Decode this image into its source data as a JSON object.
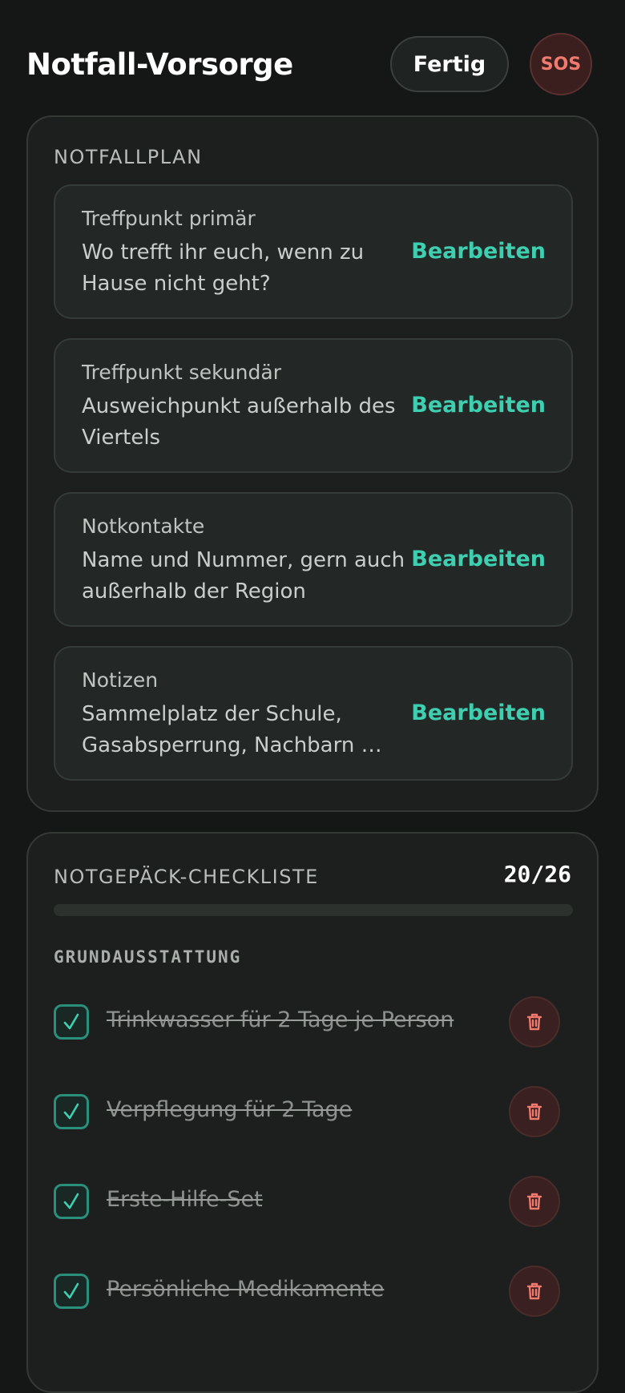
{
  "header": {
    "title": "Notfall-Vorsorge",
    "done_label": "Fertig",
    "sos_label": "SOS"
  },
  "plan": {
    "section_label": "NOTFALLPLAN",
    "edit_label": "Bearbeiten",
    "cards": [
      {
        "title": "Treffpunkt primär",
        "description": "Wo trefft ihr euch, wenn zu Hause nicht geht?"
      },
      {
        "title": "Treffpunkt sekundär",
        "description": "Ausweichpunkt außerhalb des Viertels"
      },
      {
        "title": "Notkontakte",
        "description": "Name und Nummer, gern auch außerhalb der Region"
      },
      {
        "title": "Notizen",
        "description": "Sammelplatz der Schule, Gasabsperrung, Nachbarn …"
      }
    ]
  },
  "checklist": {
    "section_label": "NOTGEPÄCK-CHECKLISTE",
    "progress_text": "20/26",
    "progress_done": 20,
    "progress_total": 26,
    "group_label": "GRUNDAUSSTATTUNG",
    "items": [
      {
        "label": "Trinkwasser für 2 Tage je Person",
        "checked": true
      },
      {
        "label": "Verpflegung für 2 Tage",
        "checked": true
      },
      {
        "label": "Erste-Hilfe-Set",
        "checked": true
      },
      {
        "label": "Persönliche Medikamente",
        "checked": true
      }
    ]
  },
  "colors": {
    "accent": "#3ecfb0",
    "danger": "#f07a6e",
    "background": "#151716",
    "panel": "#1c1f1e"
  },
  "icons": {
    "checkbox": "check-icon",
    "delete": "trash-icon"
  }
}
